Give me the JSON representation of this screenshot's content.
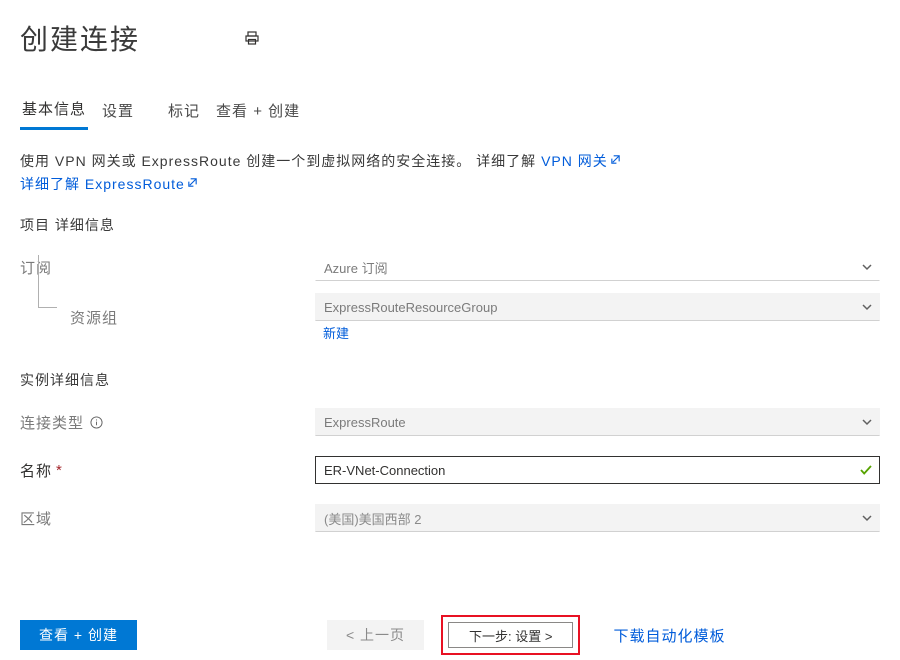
{
  "header": {
    "title": "创建连接"
  },
  "tabs": {
    "t1": "基本信息",
    "t2": "设置",
    "t3": "标记",
    "t4": "查看 + 创建"
  },
  "intro": {
    "text1": "使用 VPN 网关或 ExpressRoute 创建一个到虚拟网络的安全连接。",
    "link1_pre": "详细了解 ",
    "link1": "VPN 网关",
    "link2_pre": "详细了解 ",
    "link2": "ExpressRoute"
  },
  "sections": {
    "project": "项目 详细信息",
    "instance": "实例详细信息"
  },
  "labels": {
    "subscription": "订阅",
    "resource_group": "资源组",
    "new_rg": "新建",
    "conn_type": "连接类型",
    "name": "名称",
    "region": "区域"
  },
  "values": {
    "subscription": "Azure 订阅",
    "resource_group": "ExpressRouteResourceGroup",
    "conn_type": "ExpressRoute",
    "name": "ER-VNet-Connection",
    "region": "(美国)美国西部 2"
  },
  "footer": {
    "review": "查看 + 创建",
    "prev": "< 上一页",
    "next": "下一步: 设置 >",
    "download": "下载自动化模板"
  }
}
